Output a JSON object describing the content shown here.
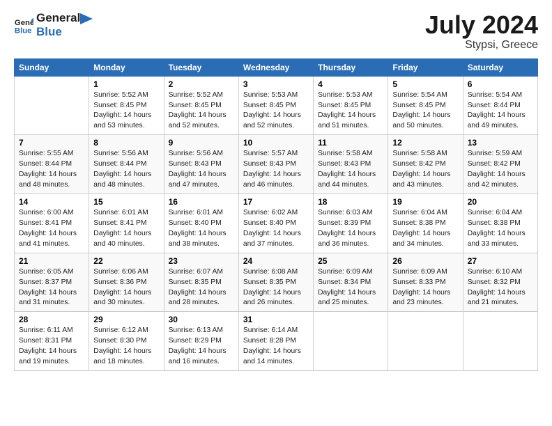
{
  "logo": {
    "line1": "General",
    "line2": "Blue"
  },
  "title": "July 2024",
  "subtitle": "Stypsi, Greece",
  "days_header": [
    "Sunday",
    "Monday",
    "Tuesday",
    "Wednesday",
    "Thursday",
    "Friday",
    "Saturday"
  ],
  "weeks": [
    [
      {
        "day": "",
        "info": ""
      },
      {
        "day": "1",
        "info": "Sunrise: 5:52 AM\nSunset: 8:45 PM\nDaylight: 14 hours\nand 53 minutes."
      },
      {
        "day": "2",
        "info": "Sunrise: 5:52 AM\nSunset: 8:45 PM\nDaylight: 14 hours\nand 52 minutes."
      },
      {
        "day": "3",
        "info": "Sunrise: 5:53 AM\nSunset: 8:45 PM\nDaylight: 14 hours\nand 52 minutes."
      },
      {
        "day": "4",
        "info": "Sunrise: 5:53 AM\nSunset: 8:45 PM\nDaylight: 14 hours\nand 51 minutes."
      },
      {
        "day": "5",
        "info": "Sunrise: 5:54 AM\nSunset: 8:45 PM\nDaylight: 14 hours\nand 50 minutes."
      },
      {
        "day": "6",
        "info": "Sunrise: 5:54 AM\nSunset: 8:44 PM\nDaylight: 14 hours\nand 49 minutes."
      }
    ],
    [
      {
        "day": "7",
        "info": "Sunrise: 5:55 AM\nSunset: 8:44 PM\nDaylight: 14 hours\nand 48 minutes."
      },
      {
        "day": "8",
        "info": "Sunrise: 5:56 AM\nSunset: 8:44 PM\nDaylight: 14 hours\nand 48 minutes."
      },
      {
        "day": "9",
        "info": "Sunrise: 5:56 AM\nSunset: 8:43 PM\nDaylight: 14 hours\nand 47 minutes."
      },
      {
        "day": "10",
        "info": "Sunrise: 5:57 AM\nSunset: 8:43 PM\nDaylight: 14 hours\nand 46 minutes."
      },
      {
        "day": "11",
        "info": "Sunrise: 5:58 AM\nSunset: 8:43 PM\nDaylight: 14 hours\nand 44 minutes."
      },
      {
        "day": "12",
        "info": "Sunrise: 5:58 AM\nSunset: 8:42 PM\nDaylight: 14 hours\nand 43 minutes."
      },
      {
        "day": "13",
        "info": "Sunrise: 5:59 AM\nSunset: 8:42 PM\nDaylight: 14 hours\nand 42 minutes."
      }
    ],
    [
      {
        "day": "14",
        "info": "Sunrise: 6:00 AM\nSunset: 8:41 PM\nDaylight: 14 hours\nand 41 minutes."
      },
      {
        "day": "15",
        "info": "Sunrise: 6:01 AM\nSunset: 8:41 PM\nDaylight: 14 hours\nand 40 minutes."
      },
      {
        "day": "16",
        "info": "Sunrise: 6:01 AM\nSunset: 8:40 PM\nDaylight: 14 hours\nand 38 minutes."
      },
      {
        "day": "17",
        "info": "Sunrise: 6:02 AM\nSunset: 8:40 PM\nDaylight: 14 hours\nand 37 minutes."
      },
      {
        "day": "18",
        "info": "Sunrise: 6:03 AM\nSunset: 8:39 PM\nDaylight: 14 hours\nand 36 minutes."
      },
      {
        "day": "19",
        "info": "Sunrise: 6:04 AM\nSunset: 8:38 PM\nDaylight: 14 hours\nand 34 minutes."
      },
      {
        "day": "20",
        "info": "Sunrise: 6:04 AM\nSunset: 8:38 PM\nDaylight: 14 hours\nand 33 minutes."
      }
    ],
    [
      {
        "day": "21",
        "info": "Sunrise: 6:05 AM\nSunset: 8:37 PM\nDaylight: 14 hours\nand 31 minutes."
      },
      {
        "day": "22",
        "info": "Sunrise: 6:06 AM\nSunset: 8:36 PM\nDaylight: 14 hours\nand 30 minutes."
      },
      {
        "day": "23",
        "info": "Sunrise: 6:07 AM\nSunset: 8:35 PM\nDaylight: 14 hours\nand 28 minutes."
      },
      {
        "day": "24",
        "info": "Sunrise: 6:08 AM\nSunset: 8:35 PM\nDaylight: 14 hours\nand 26 minutes."
      },
      {
        "day": "25",
        "info": "Sunrise: 6:09 AM\nSunset: 8:34 PM\nDaylight: 14 hours\nand 25 minutes."
      },
      {
        "day": "26",
        "info": "Sunrise: 6:09 AM\nSunset: 8:33 PM\nDaylight: 14 hours\nand 23 minutes."
      },
      {
        "day": "27",
        "info": "Sunrise: 6:10 AM\nSunset: 8:32 PM\nDaylight: 14 hours\nand 21 minutes."
      }
    ],
    [
      {
        "day": "28",
        "info": "Sunrise: 6:11 AM\nSunset: 8:31 PM\nDaylight: 14 hours\nand 19 minutes."
      },
      {
        "day": "29",
        "info": "Sunrise: 6:12 AM\nSunset: 8:30 PM\nDaylight: 14 hours\nand 18 minutes."
      },
      {
        "day": "30",
        "info": "Sunrise: 6:13 AM\nSunset: 8:29 PM\nDaylight: 14 hours\nand 16 minutes."
      },
      {
        "day": "31",
        "info": "Sunrise: 6:14 AM\nSunset: 8:28 PM\nDaylight: 14 hours\nand 14 minutes."
      },
      {
        "day": "",
        "info": ""
      },
      {
        "day": "",
        "info": ""
      },
      {
        "day": "",
        "info": ""
      }
    ]
  ]
}
